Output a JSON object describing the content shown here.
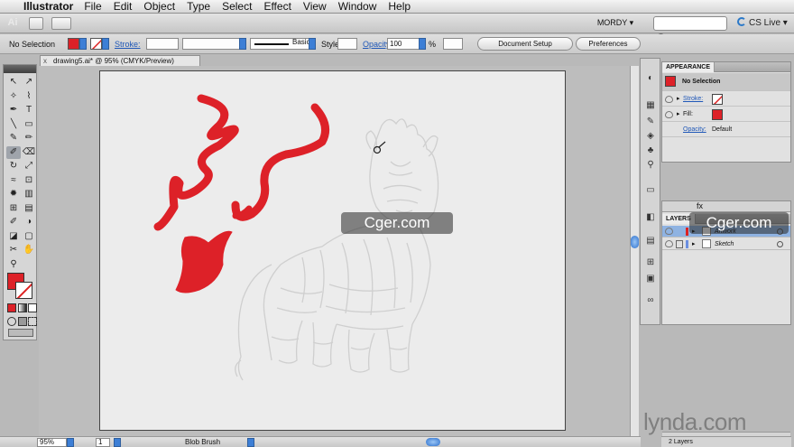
{
  "menubar": {
    "app_name": "Illustrator",
    "items": [
      "File",
      "Edit",
      "Object",
      "Type",
      "Select",
      "Effect",
      "View",
      "Window",
      "Help"
    ]
  },
  "appbar": {
    "workspace": "MORDY ▾",
    "search_placeholder": "",
    "cs_live": "CS Live ▾"
  },
  "control_bar": {
    "selection": "No Selection",
    "stroke_label": "Stroke:",
    "brush": "Basic",
    "style_label": "Style",
    "opacity_label": "Opacity:",
    "opacity_value": "100",
    "percent": "%",
    "document_setup": "Document Setup",
    "preferences": "Preferences"
  },
  "document": {
    "tab_title": "drawing5.ai* @ 95% (CMYK/Preview)",
    "tab_close": "x"
  },
  "status_bar": {
    "zoom": "95%",
    "page": "1",
    "tool_name": "Blob Brush"
  },
  "appearance": {
    "tab": "APPEARANCE",
    "header": "No Selection",
    "rows": [
      {
        "label": "Stroke:"
      },
      {
        "label": "Fill:"
      },
      {
        "label": "Opacity:",
        "value": "Default"
      }
    ]
  },
  "layers": {
    "tab": "LAYERS",
    "items": [
      "Artwork",
      "Sketch"
    ],
    "footer": "2 Layers"
  },
  "watermarks": {
    "cger_a": "Cger.com",
    "cger_b": "Cger.com",
    "lynda": "lynda.com"
  },
  "colors": {
    "fill": "#dd2128",
    "accent_blue": "#2c6fcc",
    "layer_highlight": "#8fb3e2",
    "sketch_line": "#cfcfcf"
  },
  "icons": {
    "apple": "",
    "logo": "Ai",
    "tools": [
      "selection-arrow",
      "direct-selection",
      "magic-wand",
      "lasso",
      "pen",
      "type",
      "line",
      "rectangle",
      "paintbrush",
      "pencil",
      "blob-brush",
      "eraser",
      "rotate",
      "scale",
      "warp",
      "free-transform",
      "symbol-sprayer",
      "column-graph",
      "mesh",
      "gradient",
      "eyedropper",
      "blend",
      "live-paint",
      "artboard",
      "slice",
      "hand",
      "zoom"
    ]
  }
}
